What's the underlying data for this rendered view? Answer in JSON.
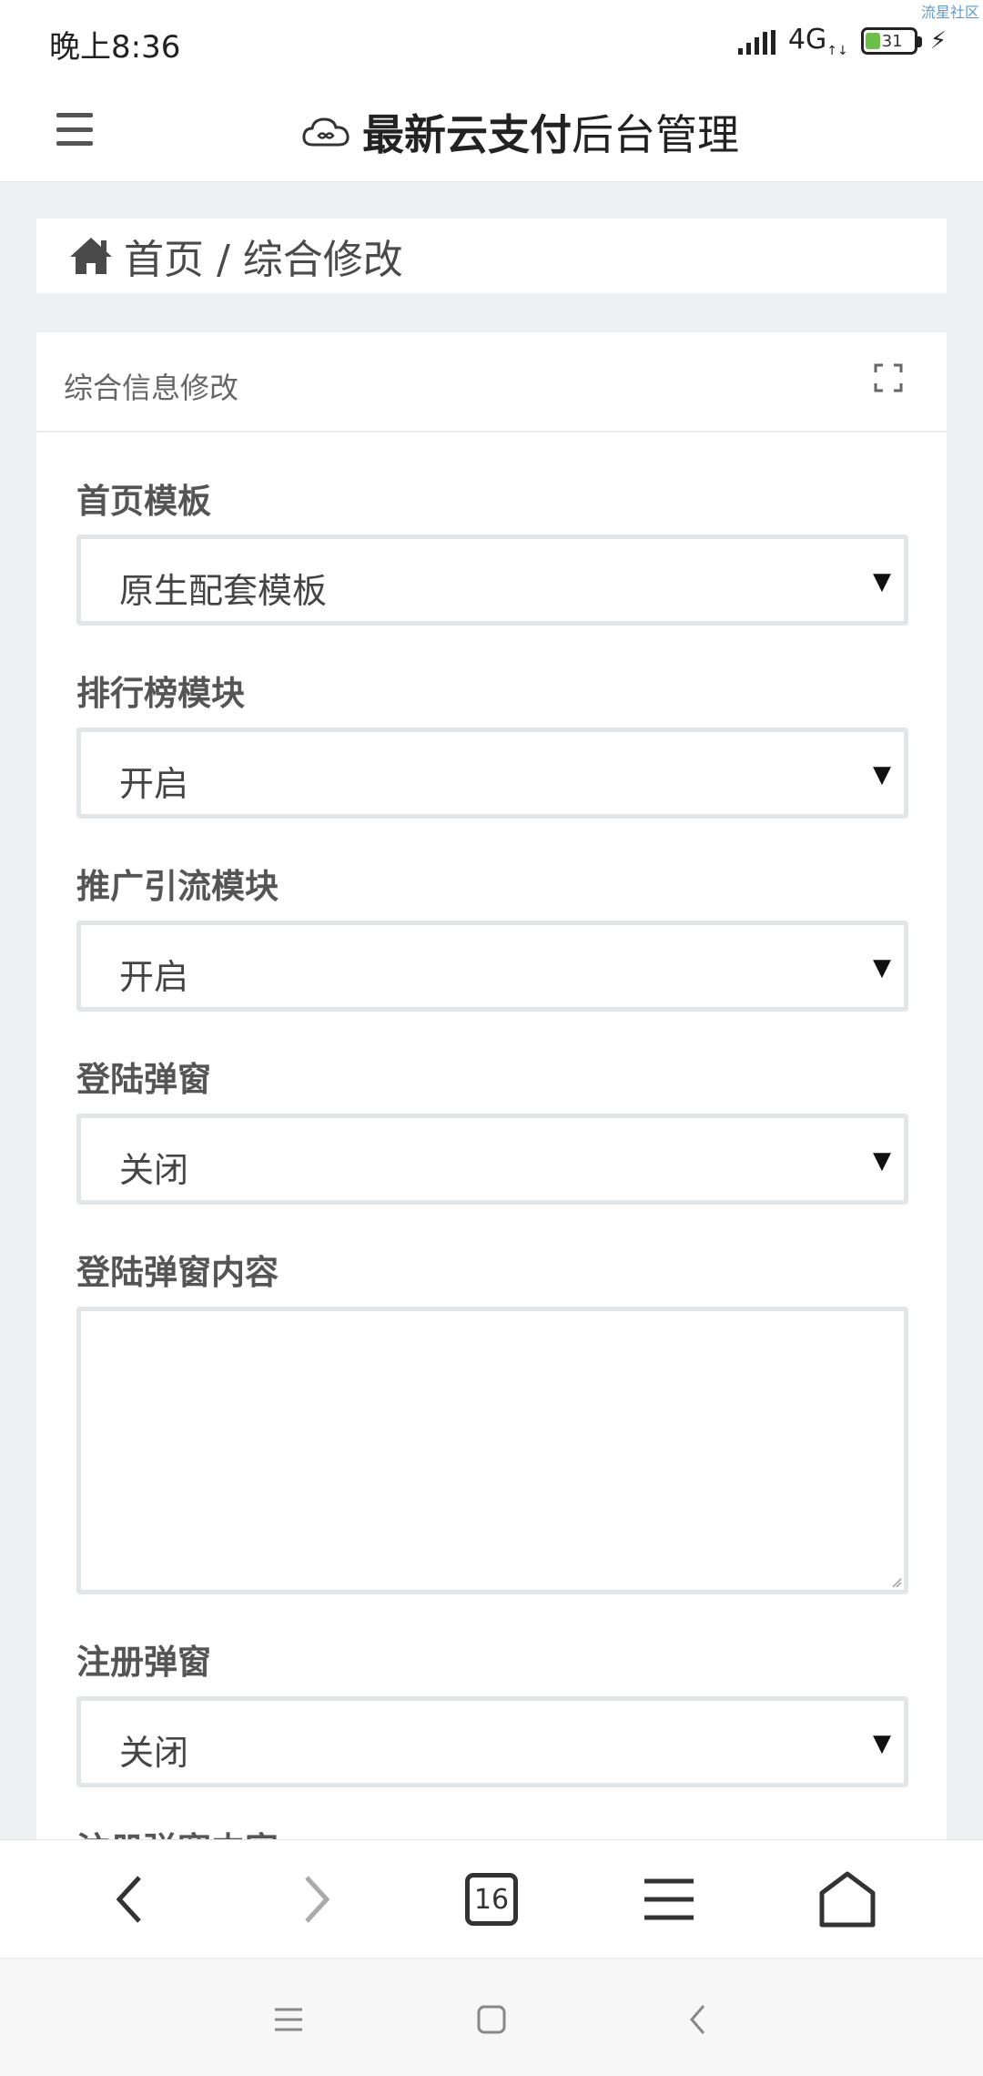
{
  "status_bar": {
    "time": "晚上8:36",
    "network": "4G",
    "battery": "31",
    "watermark": "流星社区"
  },
  "header": {
    "brand_bold": "最新云支付",
    "brand_rest": "后台管理",
    "menu_icon": "hamburger-icon",
    "logo_icon": "cloud-icon"
  },
  "breadcrumb": {
    "icon": "home-icon",
    "text": "首页 / 综合修改"
  },
  "card": {
    "title": "综合信息修改",
    "expand_icon": "fullscreen-icon"
  },
  "form": {
    "fields": [
      {
        "label": "首页模板",
        "type": "select",
        "value": "原生配套模板"
      },
      {
        "label": "排行榜模块",
        "type": "select",
        "value": "开启"
      },
      {
        "label": "推广引流模块",
        "type": "select",
        "value": "开启"
      },
      {
        "label": "登陆弹窗",
        "type": "select",
        "value": "关闭"
      },
      {
        "label": "登陆弹窗内容",
        "type": "textarea",
        "value": ""
      },
      {
        "label": "注册弹窗",
        "type": "select",
        "value": "关闭"
      }
    ],
    "next_label_partial": "注册弹窗内容"
  },
  "browser_toolbar": {
    "tab_count": "16",
    "icons": [
      "back-icon",
      "forward-icon",
      "tabs-icon",
      "menu-icon",
      "home-icon"
    ]
  },
  "system_nav": {
    "icons": [
      "recents-icon",
      "home-square-icon",
      "back-icon"
    ]
  },
  "colors": {
    "page_bg": "#eef1f2",
    "card_bg": "#ffffff",
    "input_border": "#e3e6e8",
    "label_text": "#555555",
    "battery_fill": "#6cc04a"
  }
}
